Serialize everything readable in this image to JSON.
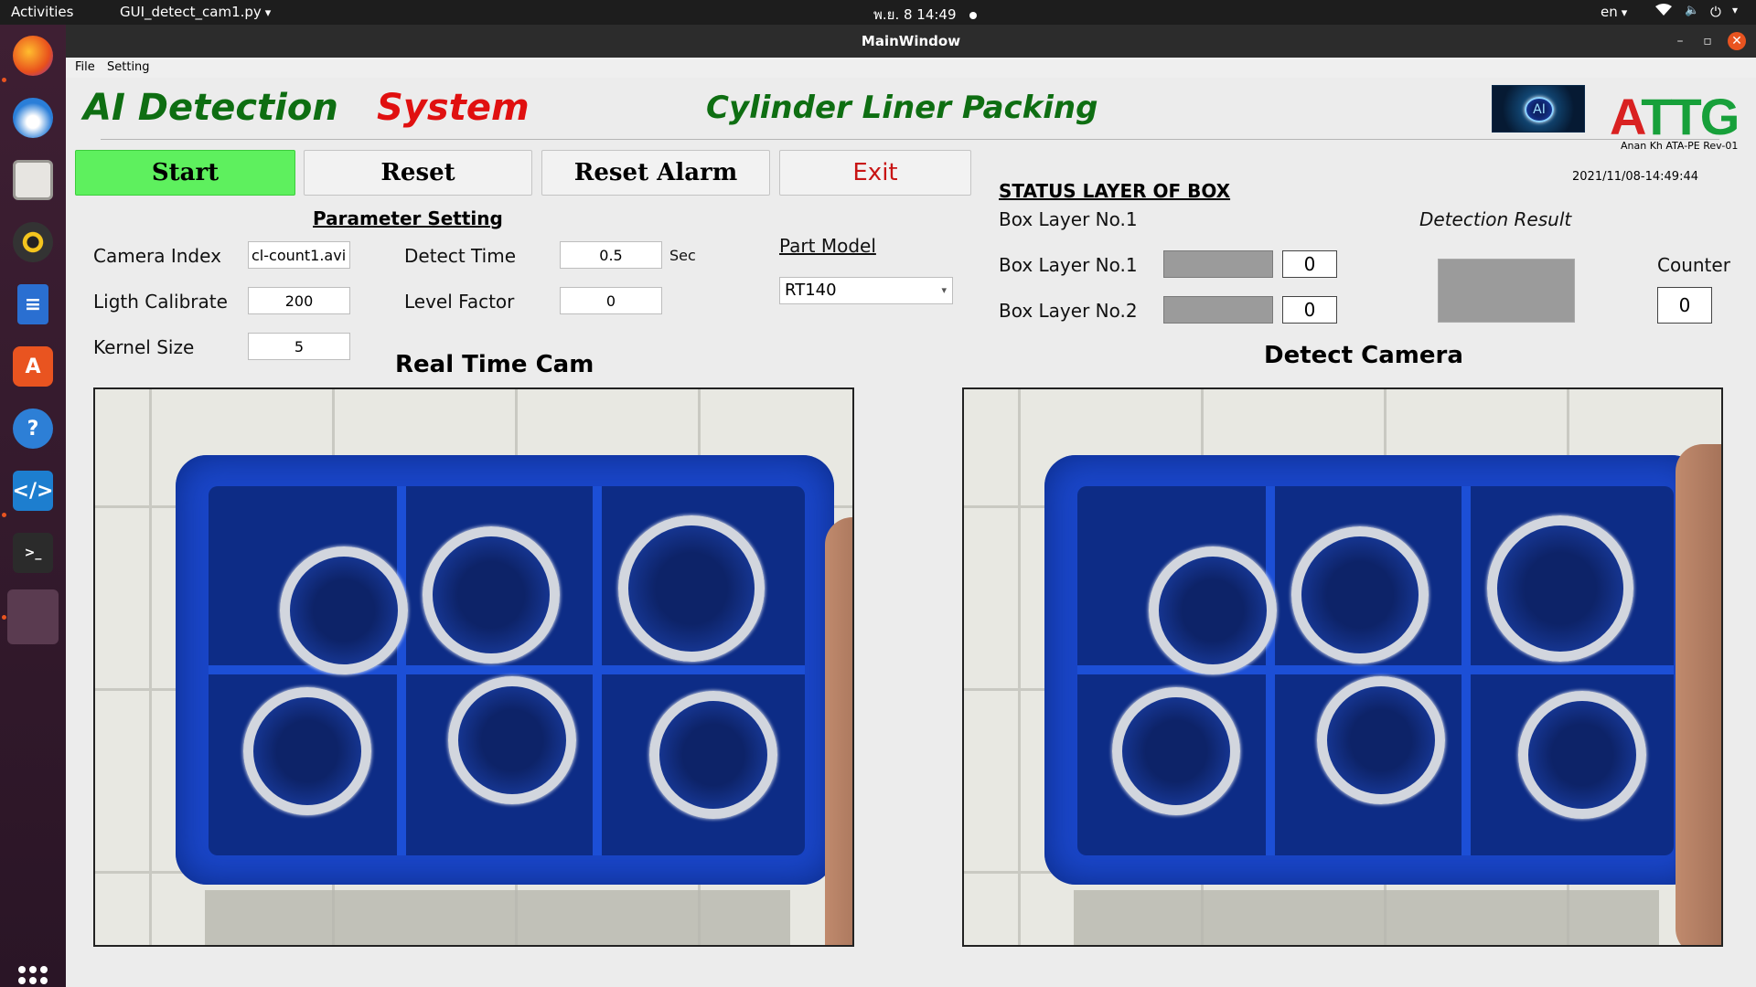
{
  "topbar": {
    "activities": "Activities",
    "app_menu": "GUI_detect_cam1.py",
    "clock": "พ.ย. 8  14:49",
    "lang": "en"
  },
  "window": {
    "title": "MainWindow"
  },
  "menu": {
    "file": "File",
    "setting": "Setting"
  },
  "header": {
    "ai_detection": "AI Detection",
    "system": "System",
    "subtitle": "Cylinder Liner Packing",
    "logo_ai": "AI",
    "logo_attg_a": "A",
    "logo_attg_ttg": "TTG",
    "author": "Anan Kh ATA-PE Rev-01",
    "datetime": "2021/11/08-14:49:44"
  },
  "buttons": {
    "start": "Start",
    "reset": "Reset",
    "reset_alarm": "Reset Alarm",
    "exit": "Exit"
  },
  "parameters": {
    "title": "Parameter Setting",
    "camera_index_label": "Camera Index",
    "camera_index_value": "cl-count1.avi",
    "light_calibrate_label": "Ligth Calibrate",
    "light_calibrate_value": "200",
    "kernel_size_label": "Kernel Size",
    "kernel_size_value": "5",
    "detect_time_label": "Detect Time",
    "detect_time_value": "0.5",
    "detect_time_unit": "Sec",
    "level_factor_label": "Level Factor",
    "level_factor_value": "0"
  },
  "part_model": {
    "label": "Part Model",
    "selected": "RT140"
  },
  "status": {
    "title": "STATUS LAYER OF BOX",
    "current_layer": "Box Layer No.1",
    "layer1_label": "Box Layer No.1",
    "layer1_count": "0",
    "layer2_label": "Box Layer No.2",
    "layer2_count": "0",
    "detection_result_label": "Detection Result",
    "counter_label": "Counter",
    "counter_value": "0",
    "indicator_color": "#9b9b9b"
  },
  "cameras": {
    "realtime_title": "Real Time Cam",
    "detect_title": "Detect Camera"
  },
  "colors": {
    "header_green": "#0e6e12",
    "header_red": "#e01010",
    "start_green": "#5ef05e",
    "exit_red": "#c81414"
  }
}
